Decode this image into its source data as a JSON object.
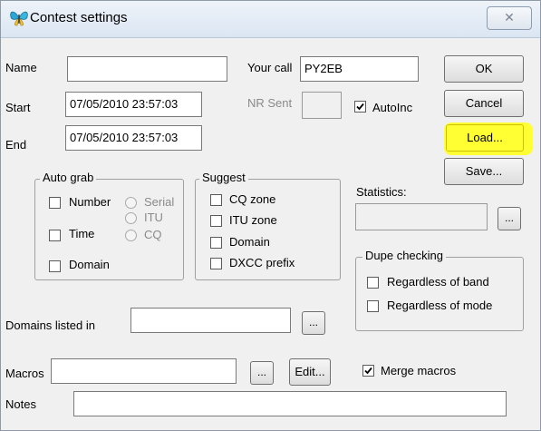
{
  "window": {
    "title": "Contest settings",
    "close_label": "✕"
  },
  "fields": {
    "name": {
      "label": "Name",
      "value": ""
    },
    "your_call": {
      "label": "Your call",
      "value": "PY2EB"
    },
    "start": {
      "label": "Start",
      "value": "07/05/2010 23:57:03"
    },
    "end": {
      "label": "End",
      "value": "07/05/2010 23:57:03"
    },
    "nr_sent": {
      "label": "NR Sent",
      "value": ""
    },
    "autoinc": {
      "label": "AutoInc",
      "checked": true
    },
    "statistics": {
      "label": "Statistics:",
      "value": ""
    },
    "domains_listed_in": {
      "label": "Domains listed in",
      "value": ""
    },
    "macros": {
      "label": "Macros",
      "value": ""
    },
    "notes": {
      "label": "Notes",
      "value": ""
    },
    "merge_macros": {
      "label": "Merge macros",
      "checked": true
    }
  },
  "buttons": {
    "ok": "OK",
    "cancel": "Cancel",
    "load": "Load...",
    "save": "Save...",
    "statistics_browse": "...",
    "domains_browse": "...",
    "macros_browse": "...",
    "edit": "Edit..."
  },
  "auto_grab": {
    "title": "Auto grab",
    "number": "Number",
    "time": "Time",
    "domain": "Domain",
    "serial": "Serial",
    "itu": "ITU",
    "cq": "CQ"
  },
  "suggest": {
    "title": "Suggest",
    "cq_zone": "CQ zone",
    "itu_zone": "ITU zone",
    "domain": "Domain",
    "dxcc_prefix": "DXCC prefix"
  },
  "dupe": {
    "title": "Dupe checking",
    "band": "Regardless of band",
    "mode": "Regardless of mode"
  },
  "colors": {
    "highlight": "#ffff33",
    "window_bg": "#f0f0f0"
  }
}
